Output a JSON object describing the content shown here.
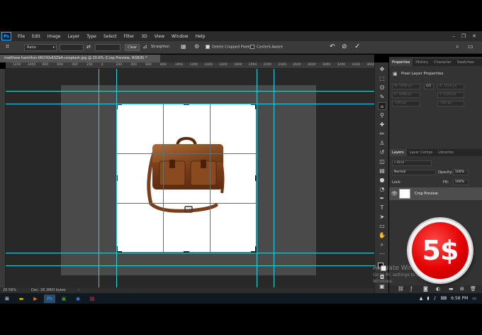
{
  "app": {
    "logo": "Ps",
    "menus": [
      "File",
      "Edit",
      "Image",
      "Layer",
      "Type",
      "Select",
      "Filter",
      "3D",
      "View",
      "Window",
      "Help"
    ],
    "window_controls": [
      "–",
      "❐",
      "✕"
    ]
  },
  "options_bar": {
    "ratio": "Ratio",
    "clear_label": "Clear",
    "straighten_label": "Straighten",
    "delete_cropped": "Delete Cropped Pixels",
    "content_aware": "Content-Aware"
  },
  "document": {
    "tab_title": "matthew-hamilton-tNCH0sKSZbA-unsplash.jpg @ 20.6% (Crop Preview, RGB/8) *",
    "zoom": "20.59%",
    "doc_size": "Doc: 26.3M/0 bytes"
  },
  "ruler": {
    "top_ticks": [
      "1200",
      "1000",
      "800",
      "600",
      "400",
      "200",
      "0",
      "200",
      "400",
      "600",
      "800",
      "1000",
      "1200",
      "1400",
      "1600",
      "1800",
      "2000",
      "2200",
      "2400",
      "2600",
      "2800",
      "3000",
      "3200",
      "3400",
      "3600"
    ]
  },
  "properties_panel": {
    "tabs": [
      "Properties",
      "History",
      "Character",
      "Swatches"
    ],
    "title": "Pixel Layer Properties",
    "w_label": "W:",
    "w_value": "5008 px",
    "h_label": "H:",
    "h_value": "5008 px",
    "x_label": "X:",
    "x_value": "1120 px",
    "y_label": "Y:",
    "y_value": "1120 px",
    "x2_value": "-120 px",
    "y2_value": "-120 px",
    "link": "GO"
  },
  "layers_panel": {
    "tabs": [
      "Layers",
      "Layer Comps",
      "Libraries"
    ],
    "kind": "Kind",
    "blend_mode": "Normal",
    "opacity_label": "Opacity:",
    "opacity": "100%",
    "lock_label": "Lock:",
    "fill_label": "Fill:",
    "fill": "100%",
    "layer_name": "Crop Preview"
  },
  "watermark": {
    "title": "Activate Windows",
    "subtitle": "Go to PC settings to activate Windows."
  },
  "badge": {
    "price": "5$"
  },
  "taskbar": {
    "time": "6:58 PM"
  },
  "colors": {
    "guide": "#28d4d4",
    "badge_red": "#e30000"
  }
}
